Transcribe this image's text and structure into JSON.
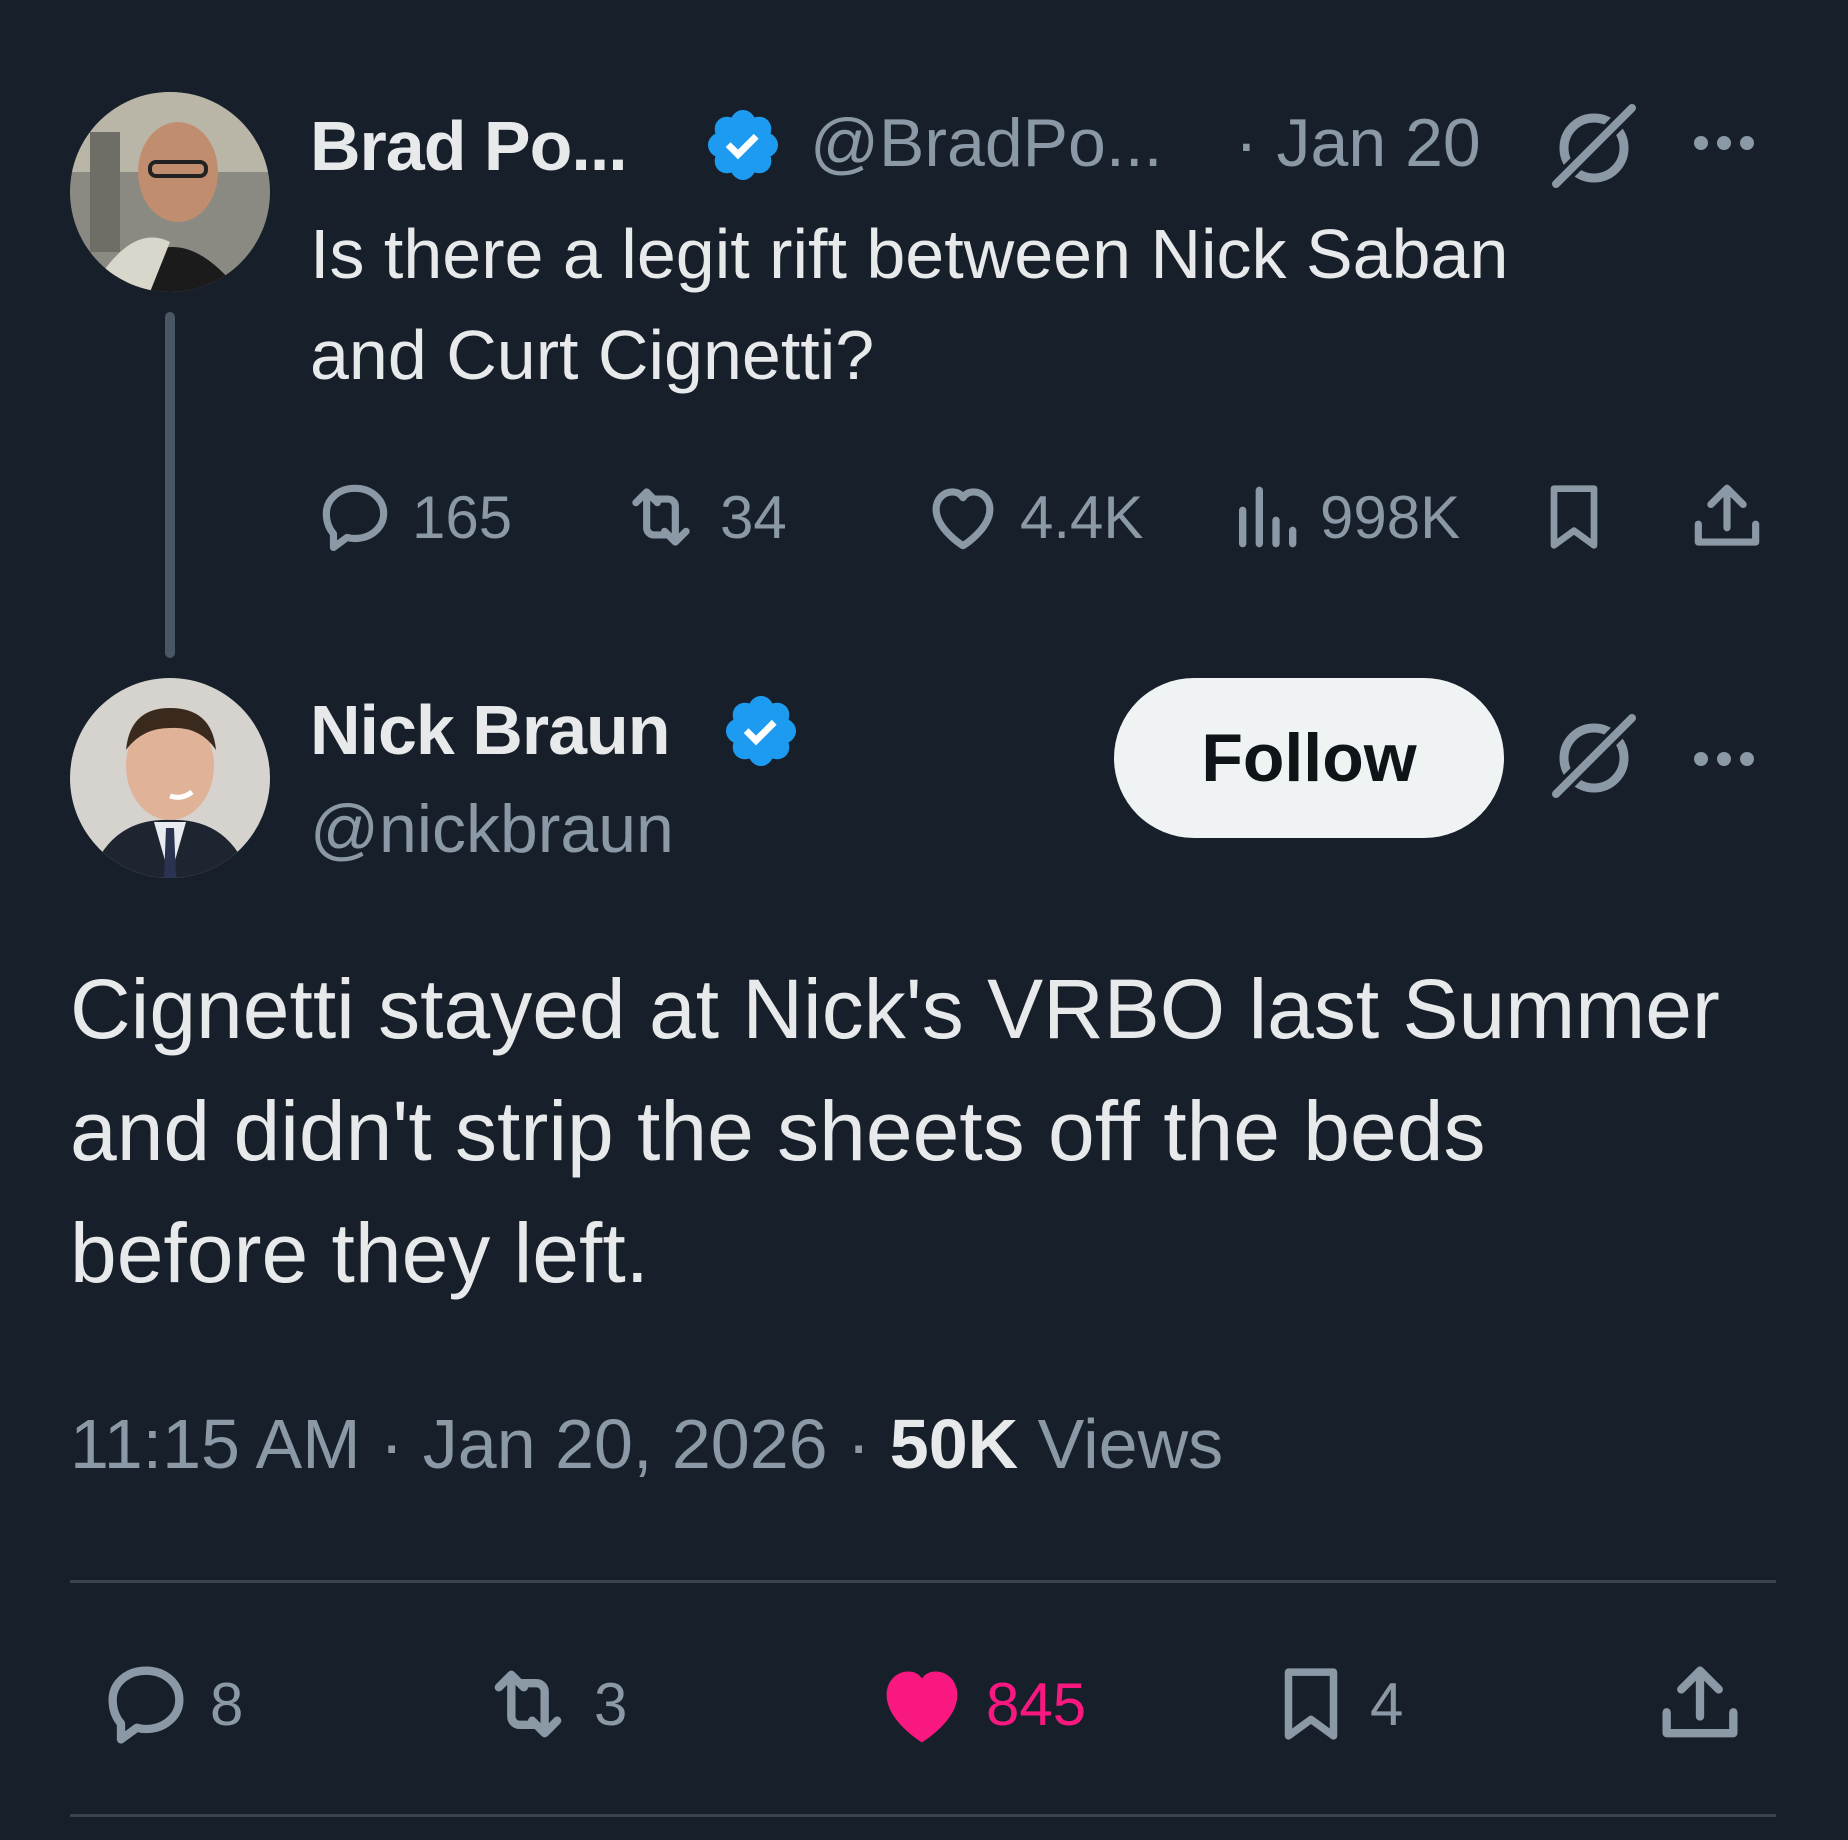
{
  "parent_tweet": {
    "author_name": "Brad Po...",
    "handle": "@BradPo...",
    "date": "· Jan 20",
    "text_line1": "Is there a legit rift between Nick Saban",
    "text_line2": "and Curt Cignetti?",
    "replies": "165",
    "reposts": "34",
    "likes": "4.4K",
    "views": "998K"
  },
  "main_tweet": {
    "author_name": "Nick Braun",
    "handle": "@nickbraun",
    "follow_label": "Follow",
    "text_line1": "Cignetti stayed at Nick's VRBO last Summer",
    "text_line2": "and didn't strip the sheets off the beds",
    "text_line3": "before they left.",
    "time": "11:15 AM",
    "date": "Jan 20, 2026",
    "views_count": "50K",
    "views_label": "Views",
    "replies": "8",
    "reposts": "3",
    "likes": "845",
    "bookmarks": "4"
  },
  "icons": [
    "verified-badge-icon",
    "grok-icon",
    "more-icon",
    "reply-icon",
    "repost-icon",
    "like-icon",
    "views-icon",
    "bookmark-icon",
    "share-icon"
  ],
  "colors": {
    "background": "#17202a",
    "text": "#e7e9ea",
    "muted": "#8b98a5",
    "verified": "#1d9bf0",
    "like_active": "#f91880",
    "follow_bg": "#eff3f4"
  }
}
